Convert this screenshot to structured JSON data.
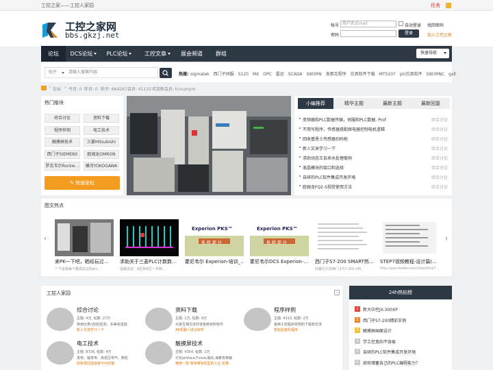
{
  "topbar": {
    "title": "工控之家——工控人家园",
    "service": "任务"
  },
  "logo": {
    "name": "工控之家网",
    "url": "bbs.gkzj.net"
  },
  "login": {
    "account_label": "帐号",
    "account_placeholder": "用户名/Email",
    "auto_login": "自动登录",
    "forgot": "找回密码",
    "password_label": "密码",
    "login_button": "登录",
    "join": "加入工控之家"
  },
  "nav": {
    "items": [
      "论坛",
      "DCS论坛",
      "PLC论坛",
      "工控文章",
      "展会频道",
      "群组"
    ],
    "quick": "快速导航"
  },
  "search": {
    "type": "帖子",
    "placeholder": "请输入搜索内容",
    "hot_label": "热搜:",
    "hot": [
      "sigmatek",
      "西门子伺服",
      "S120",
      "MX",
      "OPC",
      "雷达",
      "SCADA",
      "SW3RN",
      "发那克程序",
      "仿真软件下载",
      "MT5107",
      "plc仿真软件",
      "SW3RNC",
      "gxll"
    ]
  },
  "breadcrumb": {
    "forum": "论坛",
    "today": "今日: 0",
    "yesterday": "昨日: 0",
    "posts": "帖子: 664267",
    "members": "会员: 41132",
    "welcome": "欢迎新会员: tcvuznym"
  },
  "hot_sections": {
    "title": "热门版块",
    "tags": [
      "综合讨论",
      "资料下载",
      "程序样例",
      "电工技术",
      "触摸屏技术",
      "三菱Mitsubishi",
      "西门子SIEMENS",
      "欧姆龙OMRON",
      "罗克韦尔Rockw…",
      "横河YOKOGAWA"
    ],
    "post_button": "快速发帖"
  },
  "tabs": {
    "items": [
      "小编推荐",
      "精华主题",
      "最新主题",
      "最新回复"
    ],
    "list": [
      {
        "title": "变频器和PLC数据传输，伺服和PLC数据, Prof",
        "right": "综合讨论"
      },
      {
        "title": "不用写程序，传感器搭配继电器控制电机逻辑",
        "right": "综合讨论"
      },
      {
        "title": "回收基恩士传感器扫码枪",
        "right": "综合讨论"
      },
      {
        "title": "新人又来学习一下",
        "right": "综合讨论"
      },
      {
        "title": "求助动态王自来水处理案例",
        "right": "综合讨论"
      },
      {
        "title": "液晶模块的接口和选择",
        "right": "综合讨论"
      },
      {
        "title": "自研的PLC软件集成开发环境",
        "right": "综合讨论"
      },
      {
        "title": "欧姆龙FQ2-S视觉使用方法",
        "right": "综合讨论"
      }
    ]
  },
  "gallery": {
    "title": "图文热点",
    "items": [
      {
        "title": "来PK一下吧，晒经玩过…",
        "sub": "一下是我每个都调试过的plc…"
      },
      {
        "title": "求助关于三菱PLC计数数…",
        "sub": "因最近这：A区和B区一共两…"
      },
      {
        "title": "霍尼韦尔 Experion-培训_…",
        "sub": ""
      },
      {
        "title": "霍尼韦尔DCS Experion-…",
        "sub": ""
      },
      {
        "title": "西门子S7-200 SMART热…",
        "sub": "好赢已久的西门子S7-200 SM…"
      },
      {
        "title": "STEP7视频教程-设计篇(…",
        "sub": "http://pan.baidu.com/share/link?…"
      }
    ],
    "slide_text": [
      "Experion PKS™",
      "系 统 部 分"
    ]
  },
  "forum": {
    "title": "工控人家园",
    "boards": [
      {
        "name": "综合讨论",
        "stat": "主题: 4万, 帖数: 27万",
        "desc": "常用仪表(自控|检测、多美资送疑·",
        "last": "新人交流学习一下"
      },
      {
        "name": "资料下载",
        "stat": "主题: 1万, 帖数: 9万",
        "desc": "大家互相交流共享各种资料软件",
        "last": "AB机器人培训资料"
      },
      {
        "name": "程序样例",
        "stat": "主题: 4313, 帖数: 2万",
        "desc": "各种工控程序样例的下载和交流",
        "last": "智能贴装机程序"
      },
      {
        "name": "电工技术",
        "stat": "主题: 8726, 帖数: 4万",
        "desc": "发电、输变电、高低压电气、微机",
        "last": "四象限回送或者与可控镀"
      },
      {
        "name": "触摸屏技术",
        "stat": "主题: 4354, 帖数: 2万",
        "desc": "讨论proface,Fview,威纶,海泰克等触",
        "last": "推荐一款 简单带有机型的工业 有要…"
      }
    ]
  },
  "hot24": {
    "title": "24h热帖榜",
    "items": [
      "新大中控JX-300XP",
      "西门子S7-200精彩实例",
      "触摸屏画面设计",
      "学工控真的不容易",
      "自研的PLC软件集成开发环境",
      "如何储蓄自己的PLC编程能力？"
    ],
    "colors": [
      "#e8413a",
      "#f0852d",
      "#f2c12e",
      "#c8c8c8",
      "#c8c8c8",
      "#c8c8c8"
    ]
  }
}
